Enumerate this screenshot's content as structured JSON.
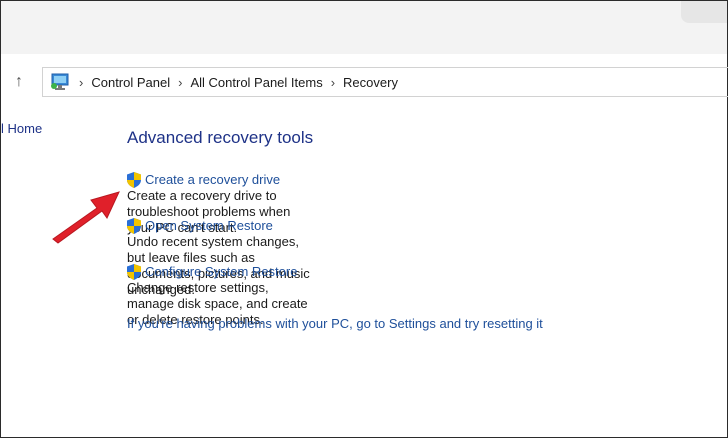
{
  "address": {
    "crumbs": [
      "Control Panel",
      "All Control Panel Items",
      "Recovery"
    ]
  },
  "left_pane": {
    "home_link": "l Home"
  },
  "main": {
    "heading": "Advanced recovery tools",
    "tools": [
      {
        "label": "Create a recovery drive",
        "description": "Create a recovery drive to troubleshoot problems when your PC can't start."
      },
      {
        "label": "Open System Restore",
        "description": "Undo recent system changes, but leave files such as documents, pictures, and music unchanged."
      },
      {
        "label": "Configure System Restore",
        "description": "Change restore settings, manage disk space, and create or delete restore points."
      }
    ],
    "settings_link": "If you're having problems with your PC, go to Settings and try resetting it"
  },
  "colors": {
    "link": "#1e4f9a",
    "heading": "#1e3287",
    "arrow": "#e0202a"
  },
  "icons": {
    "address": "control-panel-icon",
    "shield": "uac-shield-icon",
    "up": "up-arrow-icon"
  }
}
